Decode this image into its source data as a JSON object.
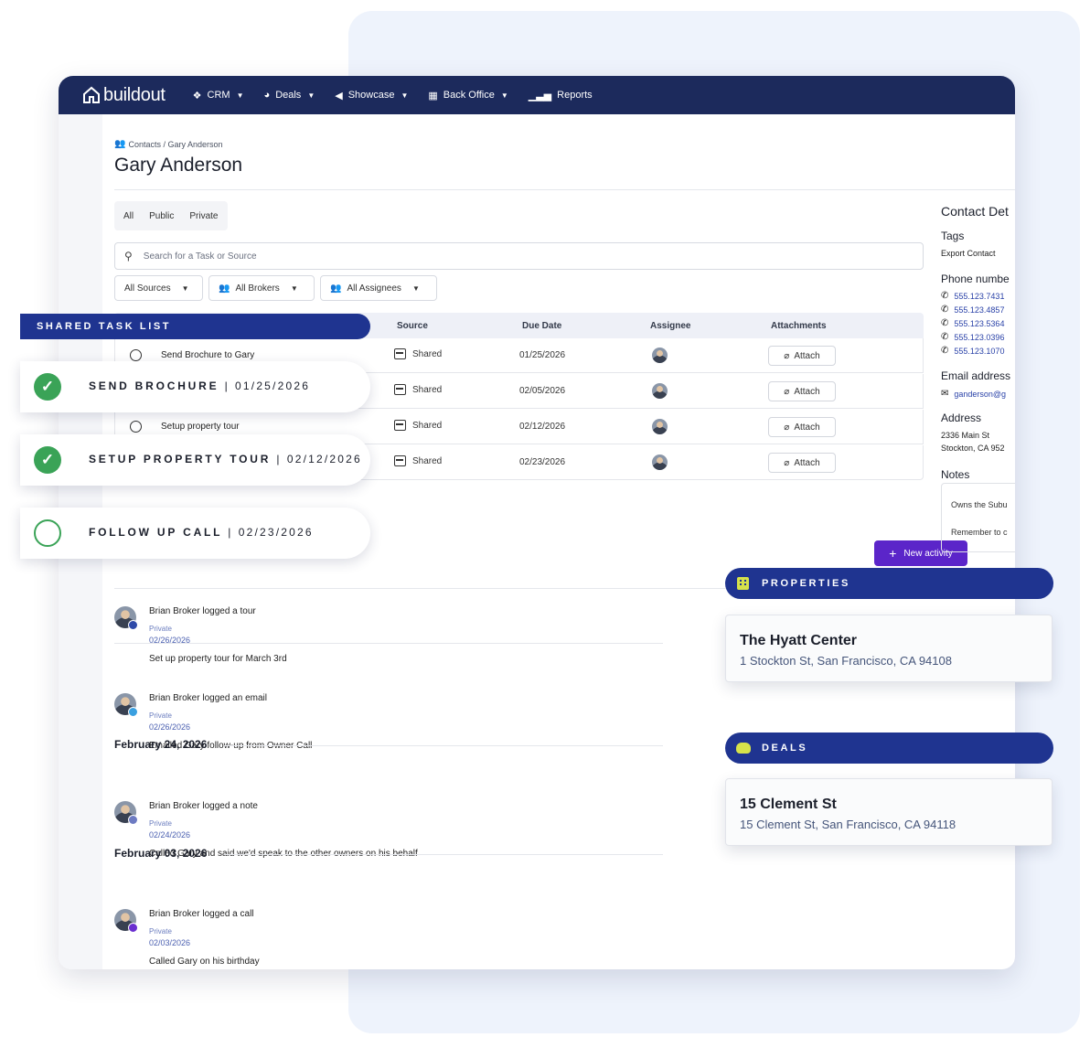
{
  "app": {
    "logo": "buildout",
    "nav": [
      {
        "label": "CRM",
        "icon": "diamond-icon"
      },
      {
        "label": "Deals",
        "icon": "handshake-icon"
      },
      {
        "label": "Showcase",
        "icon": "megaphone-icon"
      },
      {
        "label": "Back Office",
        "icon": "calculator-icon"
      },
      {
        "label": "Reports",
        "icon": "bar-chart-icon"
      }
    ]
  },
  "breadcrumb": "Contacts / Gary Anderson",
  "page_title": "Gary Anderson",
  "tabs": [
    "All",
    "Public",
    "Private"
  ],
  "search": {
    "placeholder": "Search for a Task or Source"
  },
  "filters": [
    "All Sources",
    "All Brokers",
    "All Assignees"
  ],
  "table": {
    "headers": [
      "Source",
      "Due Date",
      "Assignee",
      "Attachments"
    ],
    "rows": [
      {
        "name": "Send Brochure to Gary",
        "source": "Shared",
        "due": "01/25/2026",
        "attach": "Attach"
      },
      {
        "name": "",
        "source": "Shared",
        "due": "02/05/2026",
        "attach": "Attach"
      },
      {
        "name": "Setup property tour",
        "source": "Shared",
        "due": "02/12/2026",
        "attach": "Attach"
      },
      {
        "name": "",
        "source": "Shared",
        "due": "02/23/2026",
        "attach": "Attach"
      }
    ]
  },
  "new_activity_label": "New activity",
  "activities": [
    {
      "text": "Brian Broker logged a tour",
      "visibility": "Private",
      "date": "02/26/2026",
      "note": "Set up property tour for March 3rd",
      "badge_color": "#2f4aa8"
    },
    {
      "text": "Brian Broker logged an email",
      "visibility": "Private",
      "date": "02/26/2026",
      "note": "Emailed Gary follow-up from Owner Call",
      "badge_color": "#3aa0e0"
    },
    {
      "text": "Brian Broker logged a note",
      "visibility": "Private",
      "date": "02/24/2026",
      "note": "Called Gary and said we'd speak to the other owners on his behalf",
      "badge_color": "#6d7bc2"
    },
    {
      "text": "Brian Broker logged a call",
      "visibility": "Private",
      "date": "02/03/2026",
      "note": "Called Gary on his birthday",
      "badge_color": "#6a2fd0"
    }
  ],
  "group_dates": [
    "February 24, 2026",
    "February 03, 2026"
  ],
  "contact": {
    "title": "Contact Det",
    "tags_label": "Tags",
    "tag_value": "Export Contact",
    "phone_label": "Phone numbe",
    "phones": [
      "555.123.7431",
      "555.123.4857",
      "555.123.5364",
      "555.123.0396",
      "555.123.1070"
    ],
    "email_label": "Email address",
    "email": "ganderson@g",
    "address_label": "Address",
    "address_line1": "2336 Main St",
    "address_line2": "Stockton, CA 952",
    "notes_label": "Notes",
    "notes_line1": "Owns the Subu",
    "notes_line2": "Remember to c"
  },
  "overlay": {
    "shared_task_list": "SHARED TASK LIST",
    "pills": [
      {
        "label": "SEND BROCHURE",
        "date": "01/25/2026",
        "done": true
      },
      {
        "label": "SETUP PROPERTY TOUR",
        "date": "02/12/2026",
        "done": true
      },
      {
        "label": "FOLLOW UP CALL",
        "date": "02/23/2026",
        "done": false
      }
    ],
    "separator": "|",
    "properties_label": "PROPERTIES",
    "property": {
      "name": "The Hyatt Center",
      "address": "1 Stockton St, San Francisco, CA 94108"
    },
    "deals_label": "DEALS",
    "deal": {
      "name": "15 Clement St",
      "address": "15 Clement St, San Francisco, CA 94118"
    }
  },
  "colors": {
    "navbar": "#1c2a5c",
    "overlay_bar": "#1f3490",
    "primary_button": "#5b25c9",
    "check_green": "#3aa357",
    "icon_lime": "#d6e24a"
  }
}
